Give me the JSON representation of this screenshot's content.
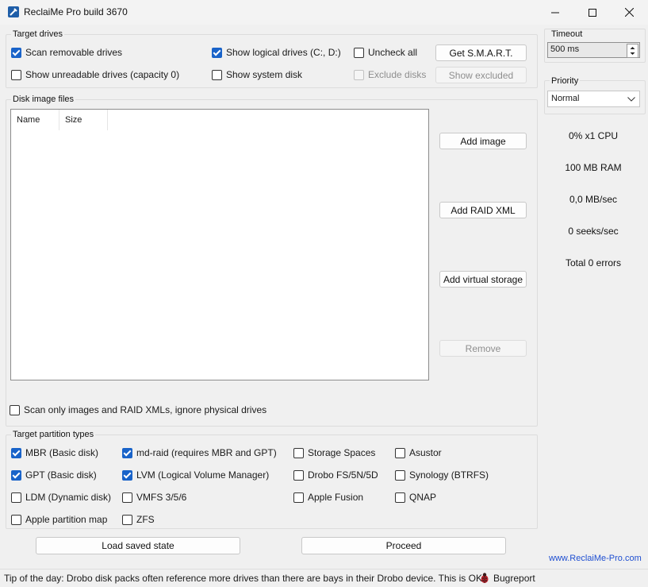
{
  "window": {
    "title": "ReclaiMe Pro build 3670"
  },
  "target_drives": {
    "label": "Target drives",
    "scan_removable": {
      "label": "Scan removable drives",
      "checked": true
    },
    "show_logical": {
      "label": "Show logical drives (C:, D:)",
      "checked": true
    },
    "uncheck_all": {
      "label": "Uncheck all",
      "checked": false
    },
    "get_smart": "Get S.M.A.R.T.",
    "show_unreadable": {
      "label": "Show unreadable drives (capacity 0)",
      "checked": false
    },
    "show_system": {
      "label": "Show system disk",
      "checked": false
    },
    "exclude_disks": {
      "label": "Exclude disks",
      "checked": false,
      "disabled": true
    },
    "show_excluded": "Show excluded"
  },
  "disk_images": {
    "label": "Disk image files",
    "columns": [
      "Name",
      "Size"
    ],
    "add_image": "Add image",
    "add_raid_xml": "Add RAID XML",
    "add_virtual_storage": "Add virtual storage",
    "remove": "Remove",
    "scan_only": {
      "label": "Scan only images and RAID XMLs, ignore physical drives",
      "checked": false
    }
  },
  "partition_types": {
    "label": "Target partition types",
    "items": [
      {
        "label": "MBR (Basic disk)",
        "checked": true
      },
      {
        "label": "md-raid (requires MBR and GPT)",
        "checked": true
      },
      {
        "label": "Storage Spaces",
        "checked": false
      },
      {
        "label": "Asustor",
        "checked": false
      },
      {
        "label": "GPT (Basic disk)",
        "checked": true
      },
      {
        "label": "LVM (Logical Volume Manager)",
        "checked": true
      },
      {
        "label": "Drobo FS/5N/5D",
        "checked": false
      },
      {
        "label": "Synology (BTRFS)",
        "checked": false
      },
      {
        "label": "LDM (Dynamic disk)",
        "checked": false
      },
      {
        "label": "VMFS 3/5/6",
        "checked": false
      },
      {
        "label": "Apple Fusion",
        "checked": false
      },
      {
        "label": "QNAP",
        "checked": false
      },
      {
        "label": "Apple partition map",
        "checked": false
      },
      {
        "label": "ZFS",
        "checked": false
      }
    ]
  },
  "bottom": {
    "load_saved_state": "Load saved state",
    "proceed": "Proceed",
    "website": "www.ReclaiMe-Pro.com"
  },
  "sidebar": {
    "timeout_label": "Timeout",
    "timeout_value": "500 ms",
    "priority_label": "Priority",
    "priority_value": "Normal",
    "stats": [
      "0% x1 CPU",
      "100 MB RAM",
      "0,0 MB/sec",
      "0 seeks/sec",
      "Total 0 errors"
    ]
  },
  "status": {
    "tip": "Tip of the day: Drobo disk packs often reference more drives than there are bays in their Drobo device. This is OK.",
    "bugreport": "Bugreport"
  },
  "colors": {
    "accent": "#1963c9",
    "link": "#1f4fd1"
  }
}
